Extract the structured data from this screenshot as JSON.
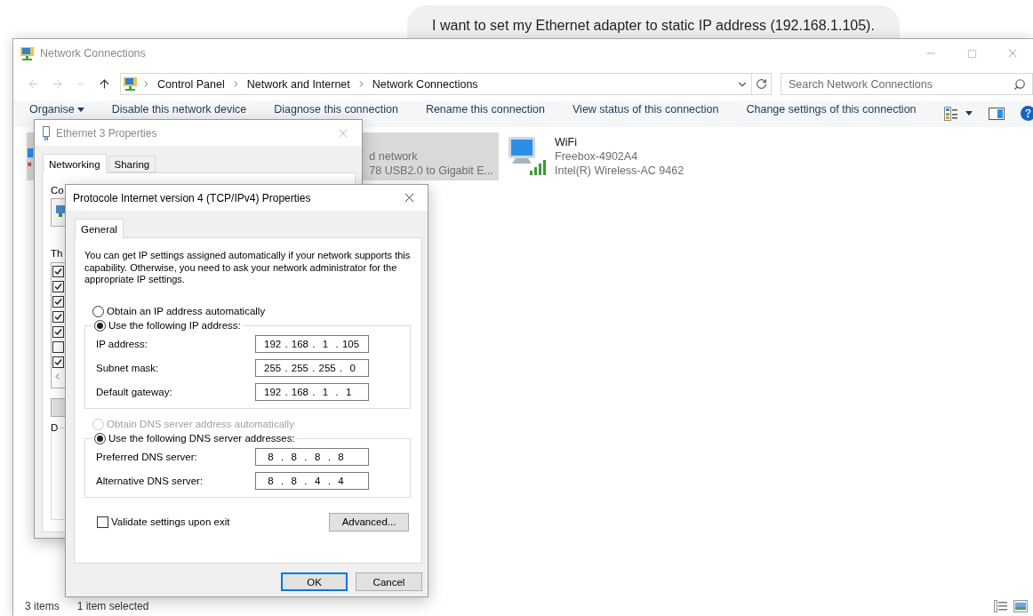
{
  "chat_bubble": {
    "text": "I want to set my Ethernet adapter to static IP address (192.168.1.105)."
  },
  "explorer": {
    "title": "Network Connections",
    "breadcrumbs": [
      "Control Panel",
      "Network and Internet",
      "Network Connections"
    ],
    "search": {
      "placeholder": "Search Network Connections"
    },
    "commands": [
      {
        "label": "Organise",
        "kind": "menu"
      },
      {
        "label": "Disable this network device",
        "kind": "action"
      },
      {
        "label": "Diagnose this connection",
        "kind": "action"
      },
      {
        "label": "Rename this connection",
        "kind": "action"
      },
      {
        "label": "View status of this connection",
        "kind": "action"
      },
      {
        "label": "Change settings of this connection",
        "kind": "action"
      }
    ],
    "connections": [
      {
        "kind": "ethernet",
        "selected": true,
        "status": "d network",
        "device": "78 USB2.0 to Gigabit E..."
      },
      {
        "kind": "wifi",
        "selected": false,
        "name": "WiFi",
        "status": "Freebox-4902A4",
        "device": "Intel(R) Wireless-AC 9462"
      }
    ],
    "status_bar": [
      "3 items",
      "1 item selected"
    ]
  },
  "ethernet_dialog": {
    "title": "Ethernet 3 Properties",
    "tabs": [
      {
        "label": "Networking",
        "selected": true
      },
      {
        "label": "Sharing",
        "selected": false
      }
    ],
    "connect_label": "Co",
    "components_label": "Th",
    "description_label": "D",
    "components": [
      {
        "checked": true
      },
      {
        "checked": true
      },
      {
        "checked": true
      },
      {
        "checked": true
      },
      {
        "checked": true
      },
      {
        "checked": false
      },
      {
        "checked": true
      }
    ]
  },
  "ipv4_dialog": {
    "title": "Protocole Internet version 4 (TCP/IPv4) Properties",
    "tabs": [
      {
        "label": "General",
        "selected": true
      }
    ],
    "intro": "You can get IP settings assigned automatically if your network supports this capability. Otherwise, you need to ask your network administrator for the appropriate IP settings.",
    "ip_auto": {
      "label": "Obtain an IP address automatically",
      "selected": false,
      "disabled": false
    },
    "ip_manual": {
      "label": "Use the following IP address:",
      "selected": true,
      "disabled": false
    },
    "ip_fields": [
      {
        "label": "IP address:",
        "value": "192 . 168 .  1  . 105"
      },
      {
        "label": "Subnet mask:",
        "value": "255 . 255 . 255 .  0"
      },
      {
        "label": "Default gateway:",
        "value": "192 . 168 .  1  .  1"
      }
    ],
    "dns_auto": {
      "label": "Obtain DNS server address automatically",
      "selected": false,
      "disabled": true
    },
    "dns_manual": {
      "label": "Use the following DNS server addresses:",
      "selected": true,
      "disabled": false
    },
    "dns_fields": [
      {
        "label": "Preferred DNS server:",
        "value": " 8  .  8  .  8  .  8"
      },
      {
        "label": "Alternative DNS server:",
        "value": " 8  .  8  .  4  .  4"
      }
    ],
    "validate": {
      "label": "Validate settings upon exit",
      "checked": false
    },
    "advanced_button": "Advanced...",
    "buttons": [
      {
        "label": "OK",
        "default": true
      },
      {
        "label": "Cancel",
        "default": false
      }
    ]
  }
}
